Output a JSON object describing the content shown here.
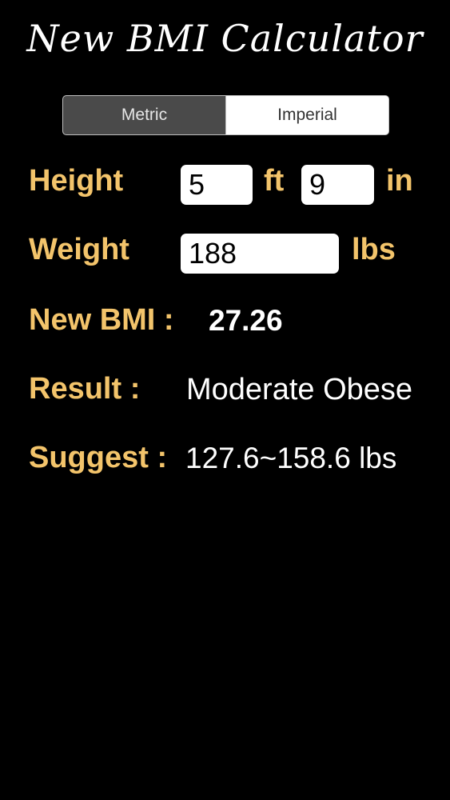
{
  "app": {
    "title": "New BMI Calculator"
  },
  "units_toggle": {
    "options": [
      "Metric",
      "Imperial"
    ],
    "selected": "Metric"
  },
  "height": {
    "label": "Height",
    "feet_value": "5",
    "feet_unit": "ft",
    "inches_value": "9",
    "inches_unit": "in"
  },
  "weight": {
    "label": "Weight",
    "value": "188",
    "unit": "lbs"
  },
  "bmi": {
    "label": "New BMI :",
    "value": "27.26"
  },
  "result": {
    "label": "Result :",
    "value": "Moderate Obese"
  },
  "suggest": {
    "label": "Suggest :",
    "value": "127.6~158.6 lbs"
  },
  "colors": {
    "background": "#000000",
    "label_accent": "#f3c46b",
    "value_text": "#ffffff",
    "segment_selected": "#4a4a4a"
  }
}
